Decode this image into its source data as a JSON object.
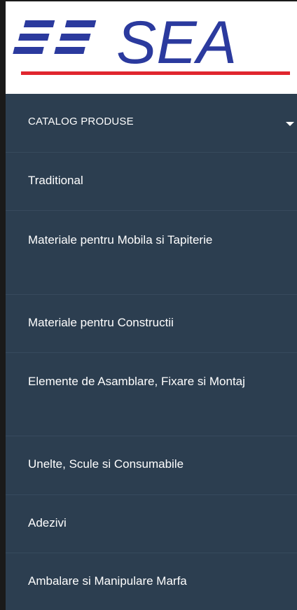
{
  "logo": {
    "text": "SEA",
    "primary_color": "#2b3a9e",
    "accent_color": "#e0262e"
  },
  "menu": {
    "header_label": "CATALOG PRODUSE",
    "header_icon": "caret-down-icon",
    "background_color": "#2c3e50",
    "items": [
      {
        "label": "Traditional"
      },
      {
        "label": "Materiale pentru Mobila si Tapiterie"
      },
      {
        "label": "Materiale pentru Constructii"
      },
      {
        "label": "Elemente de Asamblare, Fixare si Montaj"
      },
      {
        "label": "Unelte, Scule si Consumabile"
      },
      {
        "label": "Adezivi"
      },
      {
        "label": "Ambalare si Manipulare Marfa"
      }
    ]
  }
}
